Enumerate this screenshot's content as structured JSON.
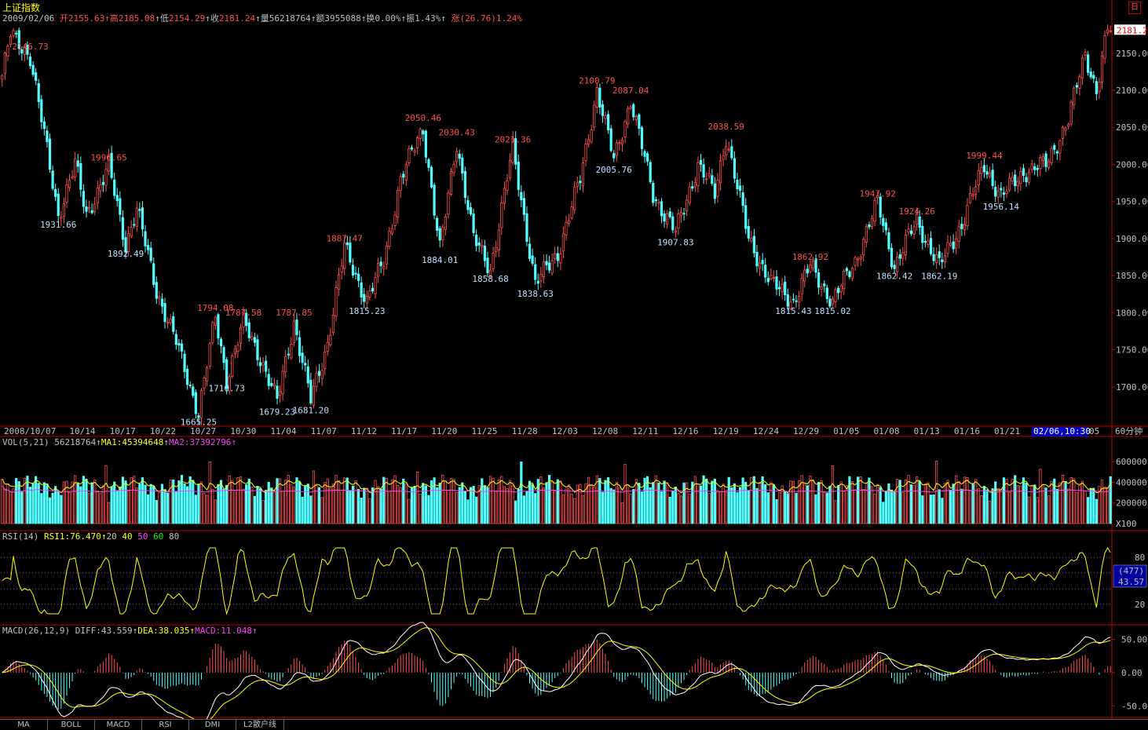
{
  "header": {
    "title": "上证指数",
    "date": "2009/02/06",
    "open_label": "开",
    "open": "2155.63",
    "high_label": "高",
    "high": "2185.08",
    "low_label": "低",
    "low": "2154.29",
    "close_label": "收",
    "close": "2181.24",
    "volume_label": "量",
    "volume": "56218764",
    "amount_label": "额",
    "amount": "3955088",
    "turnover_label": "换",
    "turnover": "0.00%",
    "amplitude_label": "振",
    "amplitude": "1.43%",
    "change_label": "涨",
    "change": "(26.76)1.24%",
    "up_arrow": "↑"
  },
  "close_button": "日",
  "price_axis": {
    "current_price": "2181.2",
    "ticks": [
      "2150.00",
      "2100.00",
      "2050.00",
      "2000.00",
      "1950.00",
      "1900.00",
      "1850.00",
      "1800.00",
      "1750.00",
      "1700.00"
    ]
  },
  "price_annotations": [
    {
      "text": "2146.73",
      "color": "red"
    },
    {
      "text": "1931.66",
      "color": "cyan"
    },
    {
      "text": "1996.65",
      "color": "red"
    },
    {
      "text": "1892.49",
      "color": "cyan"
    },
    {
      "text": "1794.08",
      "color": "red"
    },
    {
      "text": "1787.58",
      "color": "red"
    },
    {
      "text": "1710.73",
      "color": "cyan"
    },
    {
      "text": "1665.25",
      "color": "cyan"
    },
    {
      "text": "1787.85",
      "color": "red"
    },
    {
      "text": "1679.23",
      "color": "cyan"
    },
    {
      "text": "1681.20",
      "color": "cyan"
    },
    {
      "text": "1887.47",
      "color": "red"
    },
    {
      "text": "1815.23",
      "color": "cyan"
    },
    {
      "text": "2050.46",
      "color": "red"
    },
    {
      "text": "2030.43",
      "color": "red"
    },
    {
      "text": "1884.01",
      "color": "cyan"
    },
    {
      "text": "2021.36",
      "color": "red"
    },
    {
      "text": "1858.68",
      "color": "cyan"
    },
    {
      "text": "1838.63",
      "color": "cyan"
    },
    {
      "text": "2100.79",
      "color": "red"
    },
    {
      "text": "2087.04",
      "color": "red"
    },
    {
      "text": "2005.76",
      "color": "cyan"
    },
    {
      "text": "1907.83",
      "color": "cyan"
    },
    {
      "text": "2038.59",
      "color": "red"
    },
    {
      "text": "1862.92",
      "color": "red"
    },
    {
      "text": "1815.43",
      "color": "cyan"
    },
    {
      "text": "1815.02",
      "color": "cyan"
    },
    {
      "text": "1947.92",
      "color": "red"
    },
    {
      "text": "1862.42",
      "color": "cyan"
    },
    {
      "text": "1924.26",
      "color": "red"
    },
    {
      "text": "1862.19",
      "color": "cyan"
    },
    {
      "text": "1999.44",
      "color": "red"
    },
    {
      "text": "1956.14",
      "color": "cyan"
    }
  ],
  "date_axis": {
    "labels": [
      "2008/10/07",
      "10/14",
      "10/17",
      "10/22",
      "10/27",
      "10/30",
      "11/04",
      "11/07",
      "11/12",
      "11/17",
      "11/20",
      "11/25",
      "11/28",
      "12/03",
      "12/08",
      "12/11",
      "12/16",
      "12/19",
      "12/24",
      "12/29",
      "01/05",
      "01/08",
      "01/13",
      "01/16",
      "01/21"
    ],
    "cursor": "02/06,10:30",
    "last": "05",
    "period": "60分钟"
  },
  "vol_panel": {
    "label": "VOL(5,21)",
    "value": "56218764",
    "ma1_label": "MA1:",
    "ma1": "45394648",
    "ma2_label": "MA2:",
    "ma2": "37392796",
    "ticks": [
      "600000",
      "400000",
      "200000"
    ],
    "unit": "X100"
  },
  "rsi_panel": {
    "label": "RSI(14)",
    "rsi1_label": "RSI1:",
    "rsi1": "76.470",
    "levels": [
      "20",
      "40",
      "50",
      "60",
      "80"
    ],
    "ticks": [
      "80",
      "20"
    ],
    "box_top": "(477)",
    "box_bottom": "43.57"
  },
  "macd_panel": {
    "label": "MACD(26,12,9)",
    "diff_label": "DIFF:",
    "diff": "43.559",
    "dea_label": "DEA:",
    "dea": "38.035",
    "macd_label": "MACD:",
    "macd": "11.048",
    "ticks": [
      "50.00",
      "0.00",
      "-50.00"
    ]
  },
  "tabs": [
    "MA",
    "BOLL",
    "MACD",
    "RSI",
    "DMI",
    "L2散户线"
  ],
  "colors": {
    "up": "#ff5050",
    "down": "#54ffff",
    "frame": "#c00000",
    "ma1": "#ffff00",
    "ma2": "#ff40ff"
  },
  "chart_data": {
    "type": "candlestick",
    "price_ylim": [
      1650,
      2190
    ],
    "swing_points": [
      [
        0,
        2120
      ],
      [
        3,
        2175
      ],
      [
        10,
        2146.73
      ],
      [
        20,
        1931.66
      ],
      [
        26,
        2000
      ],
      [
        30,
        1931.66
      ],
      [
        38,
        1996.65
      ],
      [
        44,
        1892.49
      ],
      [
        48,
        1940
      ],
      [
        55,
        1830
      ],
      [
        62,
        1760
      ],
      [
        70,
        1665.25
      ],
      [
        76,
        1794.08
      ],
      [
        80,
        1710.73
      ],
      [
        86,
        1787.58
      ],
      [
        92,
        1740
      ],
      [
        98,
        1679.23
      ],
      [
        104,
        1787.85
      ],
      [
        110,
        1681.2
      ],
      [
        116,
        1760
      ],
      [
        122,
        1887.47
      ],
      [
        130,
        1815.23
      ],
      [
        136,
        1870
      ],
      [
        142,
        1980
      ],
      [
        150,
        2050.46
      ],
      [
        156,
        1884.01
      ],
      [
        162,
        2030.43
      ],
      [
        168,
        1900
      ],
      [
        174,
        1858.68
      ],
      [
        182,
        2021.36
      ],
      [
        190,
        1838.63
      ],
      [
        198,
        1880
      ],
      [
        206,
        1980
      ],
      [
        212,
        2100.79
      ],
      [
        218,
        2005.76
      ],
      [
        224,
        2087.04
      ],
      [
        232,
        1960
      ],
      [
        240,
        1907.83
      ],
      [
        248,
        2000
      ],
      [
        254,
        1960
      ],
      [
        258,
        2038.59
      ],
      [
        266,
        1900
      ],
      [
        274,
        1840
      ],
      [
        282,
        1815.43
      ],
      [
        288,
        1862.92
      ],
      [
        296,
        1815.02
      ],
      [
        304,
        1870
      ],
      [
        312,
        1947.92
      ],
      [
        318,
        1862.42
      ],
      [
        326,
        1924.26
      ],
      [
        334,
        1862.19
      ],
      [
        342,
        1920
      ],
      [
        350,
        1999.44
      ],
      [
        356,
        1956.14
      ],
      [
        364,
        1990
      ],
      [
        372,
        2000
      ],
      [
        380,
        2060
      ],
      [
        386,
        2150
      ],
      [
        390,
        2100
      ],
      [
        394,
        2181.24
      ]
    ],
    "rsi_ylim": [
      0,
      100
    ],
    "macd_ylim": [
      -65,
      60
    ]
  }
}
